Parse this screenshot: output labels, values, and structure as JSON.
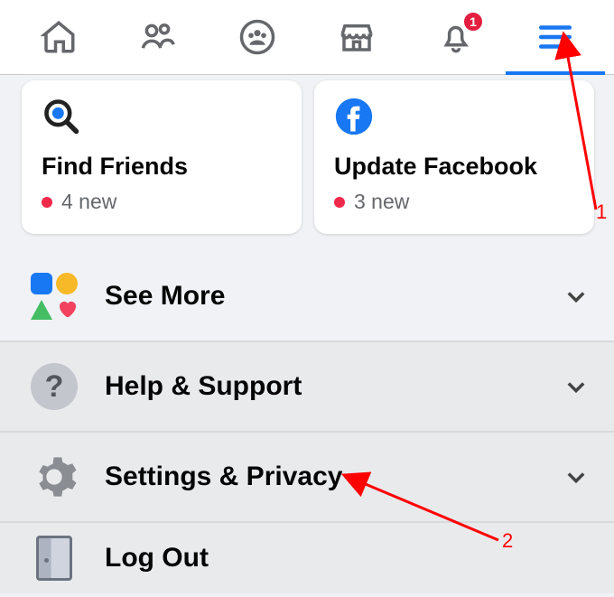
{
  "tabbar": {
    "notification_count": "1"
  },
  "cards": [
    {
      "title": "Find Friends",
      "sub": "4 new"
    },
    {
      "title": "Update Facebook",
      "sub": "3 new"
    }
  ],
  "menu": {
    "see_more": "See More",
    "help": "Help & Support",
    "settings": "Settings & Privacy",
    "logout": "Log Out"
  },
  "annotations": {
    "label1": "1",
    "label2": "2"
  }
}
